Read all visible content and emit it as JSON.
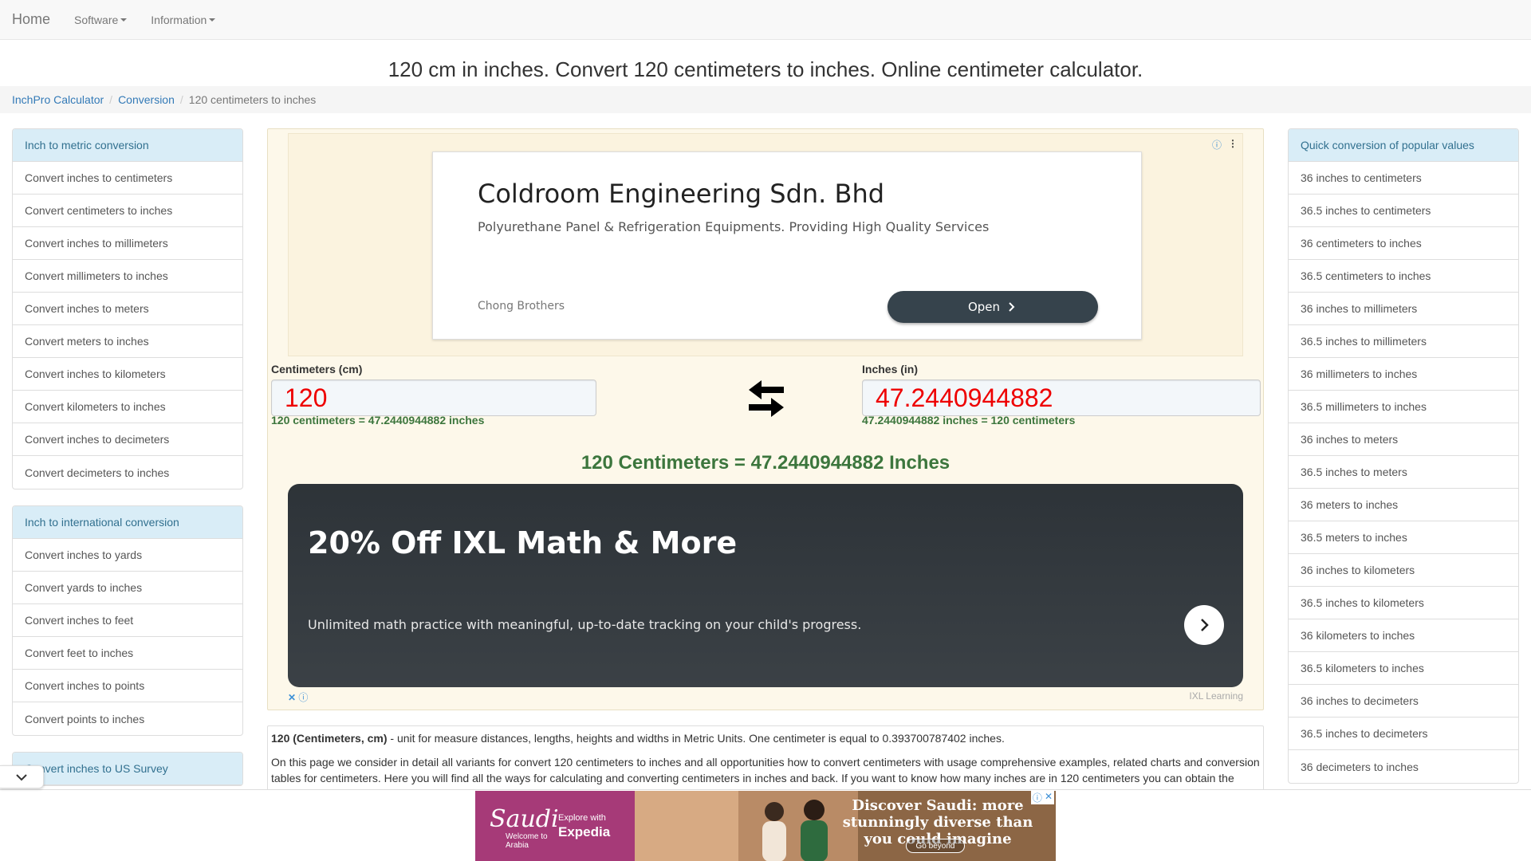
{
  "navbar": {
    "brand": "Home",
    "items": [
      {
        "label": "Software"
      },
      {
        "label": "Information"
      }
    ]
  },
  "page_title": "120 cm in inches. Convert 120 centimeters to inches. Online centimeter calculator.",
  "breadcrumb": {
    "items": [
      "InchPro Calculator",
      "Conversion"
    ],
    "active": "120 centimeters to inches"
  },
  "left_sidebar": {
    "groups": [
      {
        "heading": "Inch to metric conversion",
        "items": [
          "Convert inches to centimeters",
          "Convert centimeters to inches",
          "Convert inches to millimeters",
          "Convert millimeters to inches",
          "Convert inches to meters",
          "Convert meters to inches",
          "Convert inches to kilometers",
          "Convert kilometers to inches",
          "Convert inches to decimeters",
          "Convert decimeters to inches"
        ]
      },
      {
        "heading": "Inch to international conversion",
        "items": [
          "Convert inches to yards",
          "Convert yards to inches",
          "Convert inches to feet",
          "Convert feet to inches",
          "Convert inches to points",
          "Convert points to inches"
        ]
      },
      {
        "heading": "Convert inches to US Survey",
        "items": []
      }
    ]
  },
  "right_sidebar": {
    "heading": "Quick conversion of popular values",
    "items": [
      "36 inches to centimeters",
      "36.5 inches to centimeters",
      "36 centimeters to inches",
      "36.5 centimeters to inches",
      "36 inches to millimeters",
      "36.5 inches to millimeters",
      "36 millimeters to inches",
      "36.5 millimeters to inches",
      "36 inches to meters",
      "36.5 inches to meters",
      "36 meters to inches",
      "36.5 meters to inches",
      "36 inches to kilometers",
      "36.5 inches to kilometers",
      "36 kilometers to inches",
      "36.5 kilometers to inches",
      "36 inches to decimeters",
      "36.5 inches to decimeters",
      "36 decimeters to inches"
    ]
  },
  "ad_top": {
    "title": "Coldroom Engineering Sdn. Bhd",
    "description": "Polyurethane Panel & Refrigeration Equipments. Providing High Quality Services",
    "advertiser": "Chong Brothers",
    "button": "Open"
  },
  "converter": {
    "left_label": "Centimeters (cm)",
    "left_value": "120",
    "left_note": "120 centimeters = 47.2440944882 inches",
    "right_label": "Inches (in)",
    "right_value": "47.2440944882",
    "right_note": "47.2440944882 inches = 120 centimeters",
    "result": "120 Centimeters = 47.2440944882 Inches"
  },
  "ad_ixl": {
    "title": "20% Off IXL Math & More",
    "text": "Unlimited math practice with meaningful, up-to-date tracking on your child's progress.",
    "advertiser": "IXL Learning"
  },
  "description": {
    "p1_bold": "120 (Centimeters, cm)",
    "p1_rest": " - unit for measure distances, lengths, heights and widths in Metric Units. One centimeter is equal to 0.393700787402 inches.",
    "p2": "On this page we consider in detail all variants for convert 120 centimeters to inches and all opportunities how to convert centimeters with usage comprehensive examples, related charts and conversion tables for centimeters. Here you will find all the ways for calculating and converting centimeters in inches and back. If you want to know how many inches are in 120 centimeters you can obtain the"
  },
  "bottom_ad": {
    "brand": "Saudi",
    "welcome": "Welcome to Arabia",
    "explore": "Explore with",
    "partner": "Expedia",
    "headline": "Discover Saudi: more stunningly diverse than you could imagine",
    "cta": "Go beyond"
  },
  "colors": {
    "link": "#337ab7",
    "heading_bg": "#d9edf7",
    "result_green": "#3c763d",
    "value_red": "#ee0000"
  }
}
